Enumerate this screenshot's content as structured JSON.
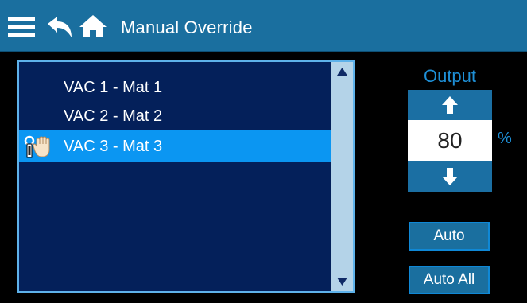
{
  "header": {
    "title": "Manual Override",
    "icons": [
      "menu-icon",
      "back-icon",
      "home-icon"
    ]
  },
  "list": {
    "items": [
      {
        "label": "VAC 1 - Mat 1",
        "selected": false
      },
      {
        "label": "VAC 2 - Mat 2",
        "selected": false
      },
      {
        "label": "VAC 3 - Mat 3",
        "selected": true,
        "icon": "manual-hold-icon"
      }
    ]
  },
  "output": {
    "label": "Output",
    "value": "80",
    "unit": "%"
  },
  "buttons": {
    "auto": "Auto",
    "auto_all": "Auto All"
  },
  "colors": {
    "header_bg": "#1a6f9f",
    "list_bg": "#04205a",
    "selected_bg": "#0b96f2",
    "accent": "#1e8fd6",
    "scrollbar": "#b4d3e8"
  }
}
